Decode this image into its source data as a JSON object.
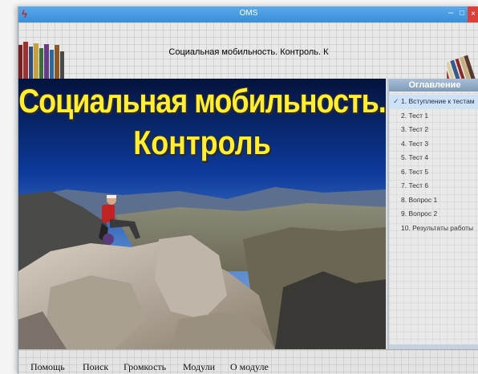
{
  "window": {
    "title": "OMS",
    "min_glyph": "–",
    "max_glyph": "□",
    "close_glyph": "×"
  },
  "header": {
    "title": "Социальная мобильность. Контроль. К"
  },
  "hero": {
    "line1": "Социальная мобильность.",
    "line2": "Контроль"
  },
  "toc": {
    "heading": "Оглавление",
    "items": [
      {
        "label": "1. Вступление к тестам",
        "active": true
      },
      {
        "label": "2. Тест 1"
      },
      {
        "label": "3. Тест 2"
      },
      {
        "label": "4. Тест 3"
      },
      {
        "label": "5. Тест 4"
      },
      {
        "label": "6. Тест 5"
      },
      {
        "label": "7. Тест 6"
      },
      {
        "label": "8. Вопрос 1"
      },
      {
        "label": "9. Вопрос 2"
      },
      {
        "label": "10. Результаты работы"
      }
    ],
    "check_glyph": "✓"
  },
  "menu": {
    "help": "Помощь",
    "search": "Поиск",
    "volume": "Громкость",
    "modules": "Модули",
    "about": "О модуле"
  },
  "colors": {
    "titlebar": "#3a8fd8",
    "hero_title": "#ffee33",
    "toc_header": "#7f9ab8",
    "close_button": "#d9413b"
  },
  "icons": [
    "app-logo-icon",
    "minimize-icon",
    "maximize-icon",
    "close-icon",
    "books-decoration",
    "checkmark-icon"
  ]
}
